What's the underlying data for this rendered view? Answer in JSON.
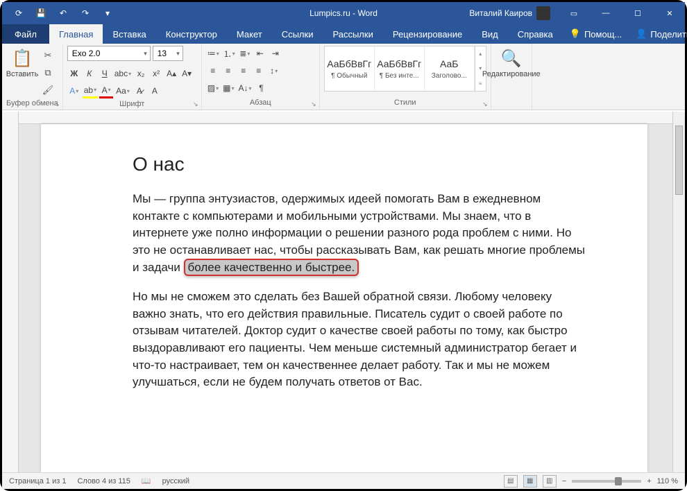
{
  "title": "Lumpics.ru - Word",
  "user": "Виталий Каиров",
  "tabs": {
    "file": "Файл",
    "home": "Главная",
    "insert": "Вставка",
    "design": "Конструктор",
    "layout": "Макет",
    "references": "Ссылки",
    "mailings": "Рассылки",
    "review": "Рецензирование",
    "view": "Вид",
    "help": "Справка",
    "tellme": "Помощ...",
    "share": "Поделиться"
  },
  "ribbon": {
    "clipboard": {
      "label": "Буфер обмена",
      "paste": "Вставить"
    },
    "font": {
      "label": "Шрифт",
      "name": "Exo 2.0",
      "size": "13"
    },
    "para": {
      "label": "Абзац"
    },
    "styles": {
      "label": "Стили",
      "s1": "АаБбВвГг",
      "s1n": "¶ Обычный",
      "s2": "АаБбВвГг",
      "s2n": "¶ Без инте...",
      "s3": "АаБ",
      "s3n": "Заголово..."
    },
    "editing": {
      "label": "Редактирование"
    }
  },
  "doc": {
    "h1": "О нас",
    "p1a": "Мы — группа энтузиастов, одержимых идеей помогать Вам в ежедневном контакте с компьютерами и мобильными устройствами. Мы знаем, что в интернете уже полно информации о решении разного рода проблем с ними. Но это не останавливает нас, чтобы рассказывать Вам, как решать многие проблемы и задачи ",
    "p1h": "более качественно и быстрее.",
    "p2": "Но мы не сможем это сделать без Вашей обратной связи. Любому человеку важно знать, что его действия правильные. Писатель судит о своей работе по отзывам читателей. Доктор судит о качестве своей работы по тому, как быстро выздоравливают его пациенты. Чем меньше системный администратор бегает и что-то настраивает, тем он качественнее делает работу. Так и мы не можем улучшаться, если не будем получать ответов от Вас."
  },
  "status": {
    "page": "Страница 1 из 1",
    "words": "Слово 4 из 115",
    "lang": "русский",
    "zoom": "110 %"
  }
}
